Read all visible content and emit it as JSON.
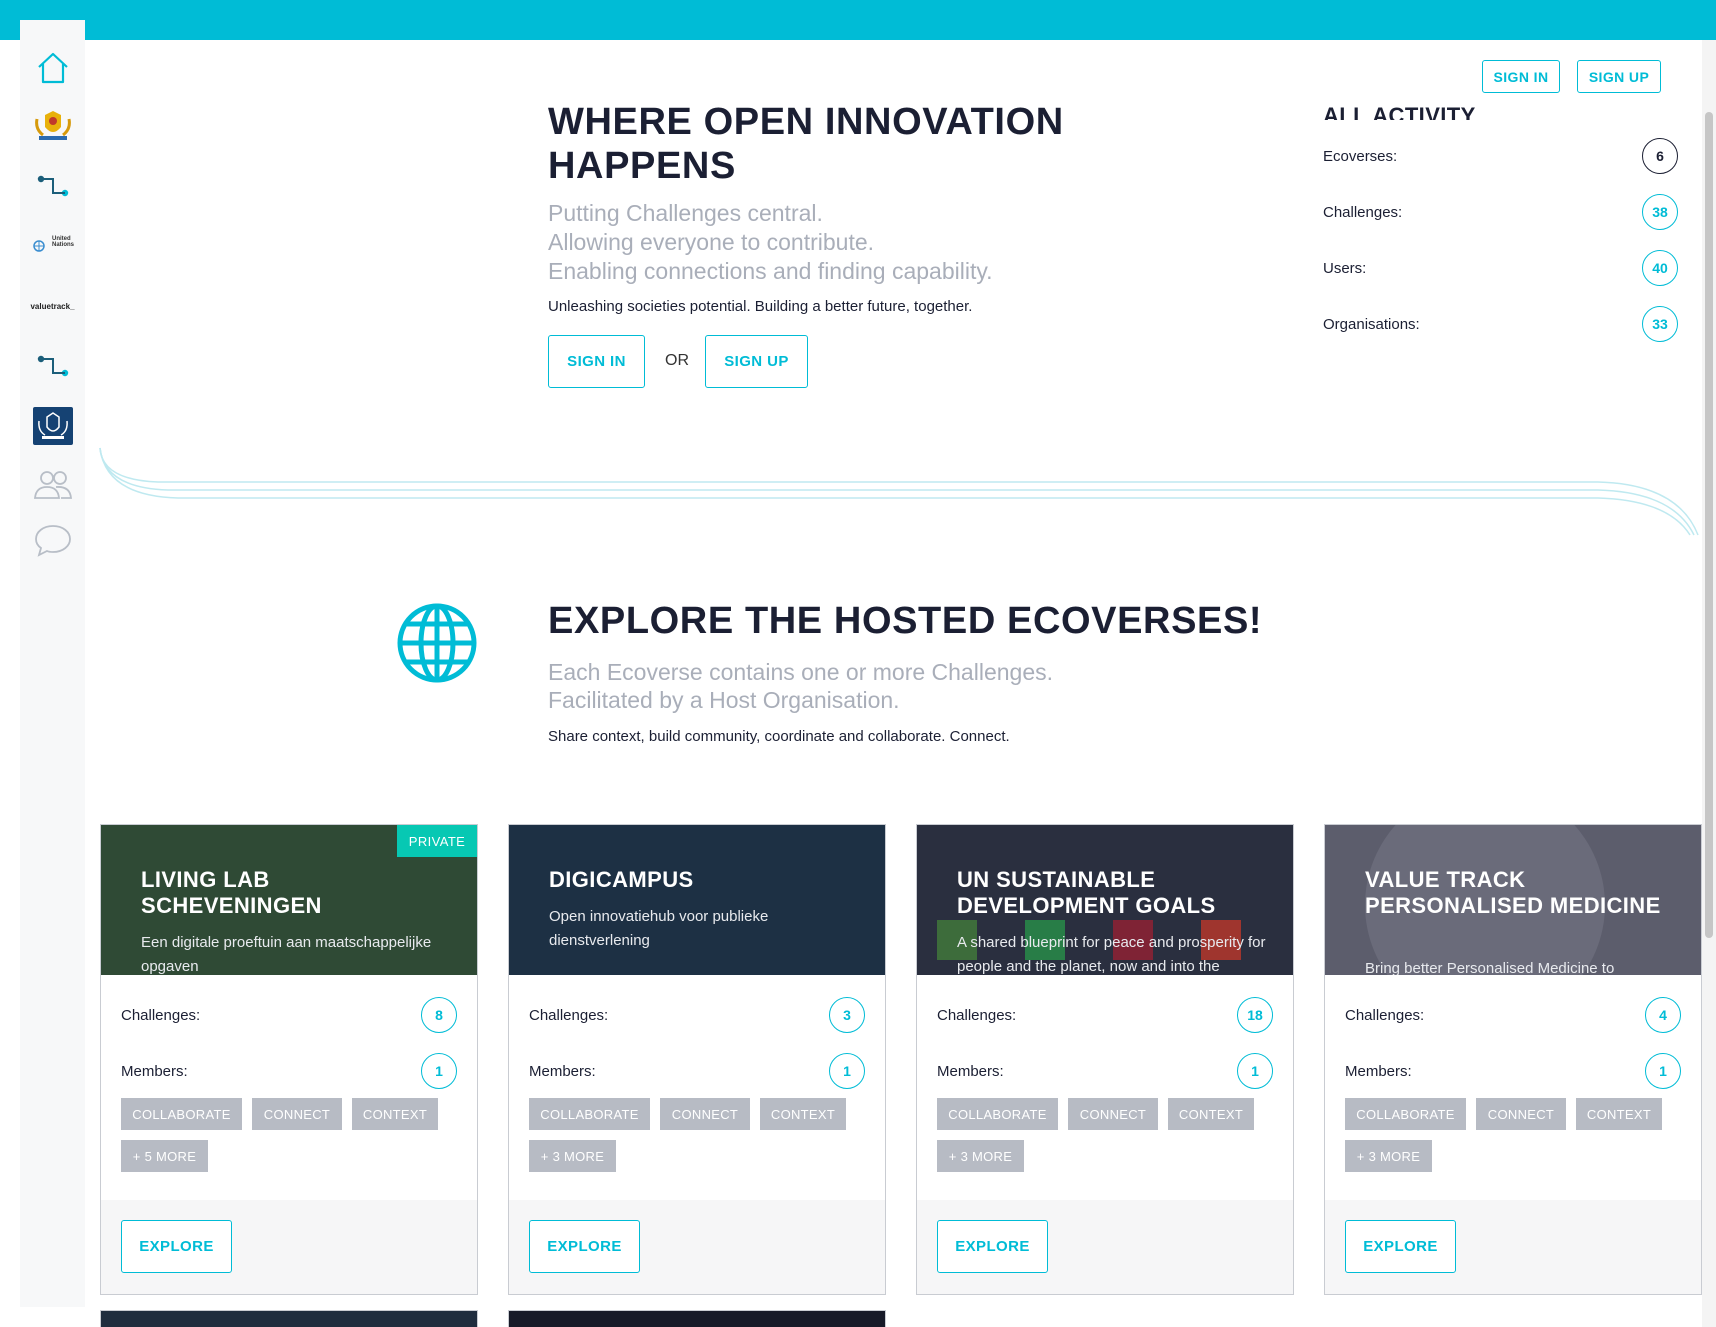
{
  "header": {
    "sign_in_label": "SIGN IN",
    "sign_up_label": "SIGN UP",
    "brand_color": "#00bcd6"
  },
  "sidebar": {
    "items": [
      {
        "name": "home",
        "icon": "home-icon"
      },
      {
        "name": "coat-of-arms",
        "icon": "coat-of-arms-icon"
      },
      {
        "name": "digicampus",
        "icon": "connector-icon"
      },
      {
        "name": "united-nations",
        "icon": "united-nations-logo",
        "text": "United Nations"
      },
      {
        "name": "valuetrack",
        "icon": "valuetrack-logo",
        "text": "valuetrack_"
      },
      {
        "name": "connector-2",
        "icon": "connector-icon"
      },
      {
        "name": "rijksoverheid",
        "icon": "rijksoverheid-icon"
      },
      {
        "name": "users",
        "icon": "users-icon"
      },
      {
        "name": "messages",
        "icon": "chat-icon"
      }
    ]
  },
  "hero": {
    "title": "WHERE OPEN INNOVATION HAPPENS",
    "lines": [
      "Putting Challenges central.",
      "Allowing everyone to contribute.",
      "Enabling connections and finding capability."
    ],
    "tagline": "Unleashing societies potential. Building a better future, together.",
    "sign_in_label": "SIGN IN",
    "or_label": "OR",
    "sign_up_label": "SIGN UP"
  },
  "activity": {
    "title": "ALL ACTIVITY",
    "rows": [
      {
        "label": "Ecoverses:",
        "value": "6"
      },
      {
        "label": "Challenges:",
        "value": "38"
      },
      {
        "label": "Users:",
        "value": "40"
      },
      {
        "label": "Organisations:",
        "value": "33"
      }
    ]
  },
  "explore": {
    "title": "EXPLORE THE HOSTED ECOVERSES!",
    "lines": [
      "Each Ecoverse contains one or more Challenges.",
      "Facilitated by a Host Organisation."
    ],
    "tagline": "Share context, build community, coordinate and collaborate. Connect."
  },
  "cards": [
    {
      "title": "LIVING LAB SCHEVENINGEN",
      "description": "Een digitale proeftuin aan maatschappelijke opgaven",
      "badge": "PRIVATE",
      "challenges_label": "Challenges:",
      "challenges": "8",
      "members_label": "Members:",
      "members": "1",
      "tags": [
        "COLLABORATE",
        "CONNECT",
        "CONTEXT"
      ],
      "more": "+ 5 MORE",
      "explore_label": "EXPLORE",
      "header_color": "#2f4a35"
    },
    {
      "title": "DIGICAMPUS",
      "description": "Open innovatiehub voor publieke dienstverlening",
      "challenges_label": "Challenges:",
      "challenges": "3",
      "members_label": "Members:",
      "members": "1",
      "tags": [
        "COLLABORATE",
        "CONNECT",
        "CONTEXT"
      ],
      "more": "+ 3 MORE",
      "explore_label": "EXPLORE",
      "header_color": "#1d3044"
    },
    {
      "title": "UN SUSTAINABLE DEVELOPMENT GOALS",
      "description": "A shared blueprint for peace and prosperity for people and the planet, now and into the",
      "challenges_label": "Challenges:",
      "challenges": "18",
      "members_label": "Members:",
      "members": "1",
      "tags": [
        "COLLABORATE",
        "CONNECT",
        "CONTEXT"
      ],
      "more": "+ 3 MORE",
      "explore_label": "EXPLORE",
      "header_color": "#2a2f3f"
    },
    {
      "title": "VALUE TRACK PERSONALISED MEDICINE",
      "description": "Bring better Personalised Medicine to",
      "challenges_label": "Challenges:",
      "challenges": "4",
      "members_label": "Members:",
      "members": "1",
      "tags": [
        "COLLABORATE",
        "CONNECT",
        "CONTEXT"
      ],
      "more": "+ 3 MORE",
      "explore_label": "EXPLORE",
      "header_color": "#5c5d6c"
    }
  ]
}
